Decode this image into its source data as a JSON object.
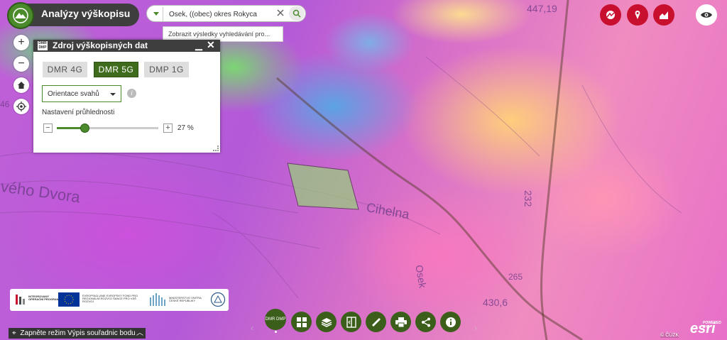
{
  "app": {
    "title": "Analýzy výškopisu"
  },
  "search": {
    "value": "Osek, ((obec) okres Rokyca",
    "suggestion": "Zobrazit výsledky vyhledávání pro..."
  },
  "map_labels": {
    "label1": "véhо Dvora",
    "label2": "Cihelna",
    "label3": "232",
    "label4": "447,19",
    "label5": "430,6",
    "label6": "265",
    "label7": "46",
    "label8": "Osek"
  },
  "panel": {
    "title": "Zdroj výškopisných dat",
    "icon_text": "DMR DMP",
    "buttons": [
      {
        "label": "DMR 4G",
        "active": false
      },
      {
        "label": "DMR 5G",
        "active": true
      },
      {
        "label": "DMP 1G",
        "active": false
      }
    ],
    "select_value": "Orientace svahů",
    "transparency_label": "Nastavení průhlednosti",
    "transparency_percent": 27,
    "transparency_text": "27 %"
  },
  "toolbar": {
    "dmr_label": "DMR DMP",
    "items": [
      "grid-icon",
      "layers-icon",
      "compare-icon",
      "ruler-icon",
      "print-icon",
      "share-icon",
      "info-icon"
    ]
  },
  "coord_bar": {
    "label": "Zapněte režim Výpis souřadnic bodu"
  },
  "attribution": {
    "cuzk": "© ČÚZK",
    "esri": "esri",
    "powered": "POWERED BY"
  },
  "logos": {
    "op": "INTEGROVANÝ OPERAČNÍ PROGRAM",
    "eu": "EVROPSKÁ UNIE EVROPSKÝ FOND PRO REGIONÁLNÍ ROZVOJ ŠANCE PRO VÁŠ ROZVOJ",
    "mmr": "MINISTERSTVO VNITRA ČESKÉ REPUBLIKY"
  },
  "colors": {
    "accent_green": "#3b5f1a",
    "red_buttons": "#c8102e",
    "header_dark": "#3e3e3e"
  }
}
